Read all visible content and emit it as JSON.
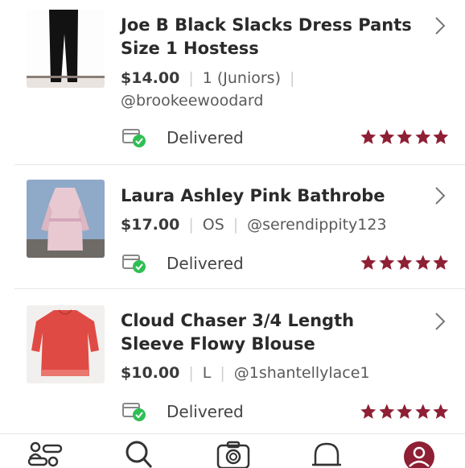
{
  "orders": [
    {
      "title_line1": "Joe B Black Slacks Dress Pants",
      "title_line2": "Size 1 Hostess",
      "price": "$14.00",
      "size": "1 (Juniors)",
      "seller": "@brookeewoodard",
      "status": "Delivered",
      "rating": 5
    },
    {
      "title_line1": "Laura Ashley Pink Bathrobe",
      "title_line2": "",
      "price": "$17.00",
      "size": "OS",
      "seller": "@serendippity123",
      "status": "Delivered",
      "rating": 5
    },
    {
      "title_line1": "Cloud Chaser 3/4 Length",
      "title_line2": "Sleeve Flowy Blouse",
      "price": "$10.00",
      "size": "L",
      "seller": "@1shantellylace1",
      "status": "Delivered",
      "rating": 5
    }
  ],
  "colors": {
    "star": "#8e1f34",
    "delivered_check": "#2fbf55",
    "nav_active": "#8e1f34"
  },
  "icons": {
    "chevron": "chevron-right-icon",
    "delivered": "delivered-box-icon",
    "star": "star-icon",
    "nav": [
      "feed-icon",
      "search-icon",
      "camera-icon",
      "news-bell-icon",
      "profile-icon"
    ]
  }
}
